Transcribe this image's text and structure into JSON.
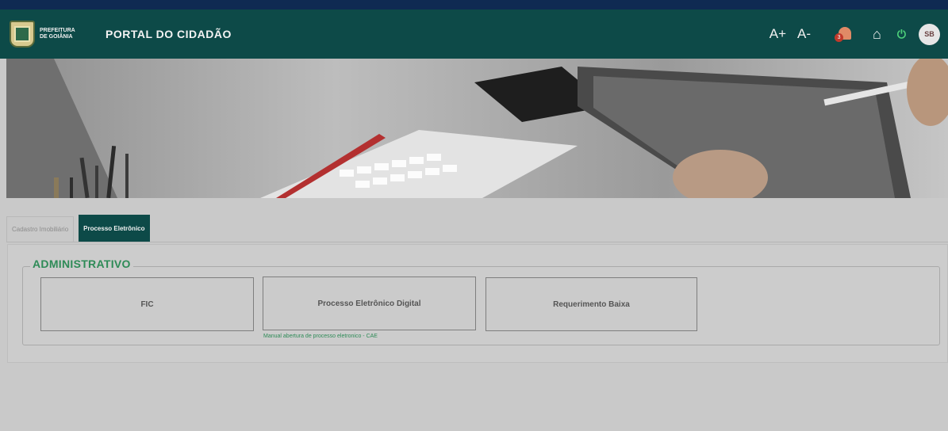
{
  "header": {
    "logo_text": "PREFEITURA DE GOIÂNIA",
    "title": "PORTAL DO CIDADÃO",
    "font_increase": "A+",
    "font_decrease": "A-",
    "notification_count": "3",
    "home_icon": "home-icon",
    "power_icon": "power-icon",
    "avatar_initials": "SB"
  },
  "tabs": [
    {
      "label": "Cadastro Imobiliário",
      "active": false
    },
    {
      "label": "Processo Eletrônico",
      "active": true
    }
  ],
  "section": {
    "legend": "ADMINISTRATIVO",
    "cards": [
      {
        "label": "FIC"
      },
      {
        "label": "Processo Eletrônico Digital",
        "link": "Manual abertura de processo eletronico - CAE"
      },
      {
        "label": "Requerimento Baixa"
      }
    ]
  },
  "colors": {
    "navbar": "#0d4a48",
    "accent_green": "#2e8b57",
    "background": "#c9c9c9"
  }
}
